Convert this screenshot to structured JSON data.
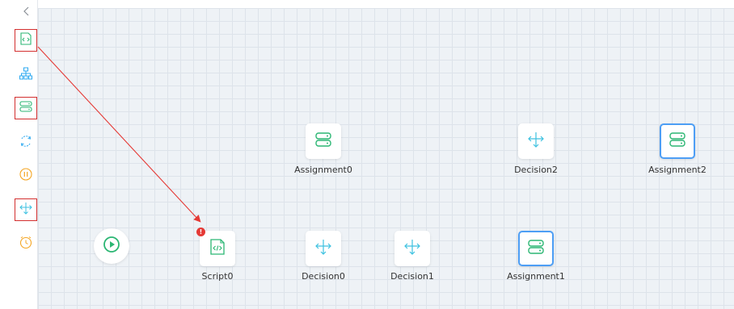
{
  "canvas": {
    "nodes": [
      {
        "id": "assignment0",
        "label": "Assignment0",
        "kind": "assignment"
      },
      {
        "id": "decision2",
        "label": "Decision2",
        "kind": "decision"
      },
      {
        "id": "assignment2",
        "label": "Assignment2",
        "kind": "assignment",
        "selected": true
      },
      {
        "id": "script0",
        "label": "Script0",
        "kind": "script",
        "has_error": true
      },
      {
        "id": "decision0",
        "label": "Decision0",
        "kind": "decision"
      },
      {
        "id": "decision1",
        "label": "Decision1",
        "kind": "decision"
      },
      {
        "id": "assignment1",
        "label": "Assignment1",
        "kind": "assignment",
        "selected": true
      }
    ],
    "start_node": {
      "icon": "play-icon"
    },
    "error_badge": "!"
  },
  "sidebar": {
    "collapse_icon": "chevron-left-icon",
    "tools": [
      {
        "name": "script-tool",
        "icon": "code-icon",
        "highlighted": true
      },
      {
        "name": "structure-tool",
        "icon": "hierarchy-icon",
        "highlighted": false
      },
      {
        "name": "assignment-tool",
        "icon": "storage-icon",
        "highlighted": true
      },
      {
        "name": "loop-tool",
        "icon": "refresh-icon",
        "highlighted": false
      },
      {
        "name": "pause-tool",
        "icon": "pause-icon",
        "highlighted": false
      },
      {
        "name": "decision-tool",
        "icon": "split-arrows-icon",
        "highlighted": true
      },
      {
        "name": "timer-tool",
        "icon": "clock-icon",
        "highlighted": false
      }
    ]
  },
  "annotation": {
    "drag_arrow_color": "#e53935",
    "highlight_box_color": "#d32f2f"
  },
  "colors": {
    "green": "#2bb673",
    "blue": "#2ba8f0",
    "cyan": "#3dc1e0",
    "orange": "#f5a623",
    "canvas_bg": "#eef2f6",
    "grid": "#dde3ea",
    "selected_border": "#4d9ef5"
  }
}
